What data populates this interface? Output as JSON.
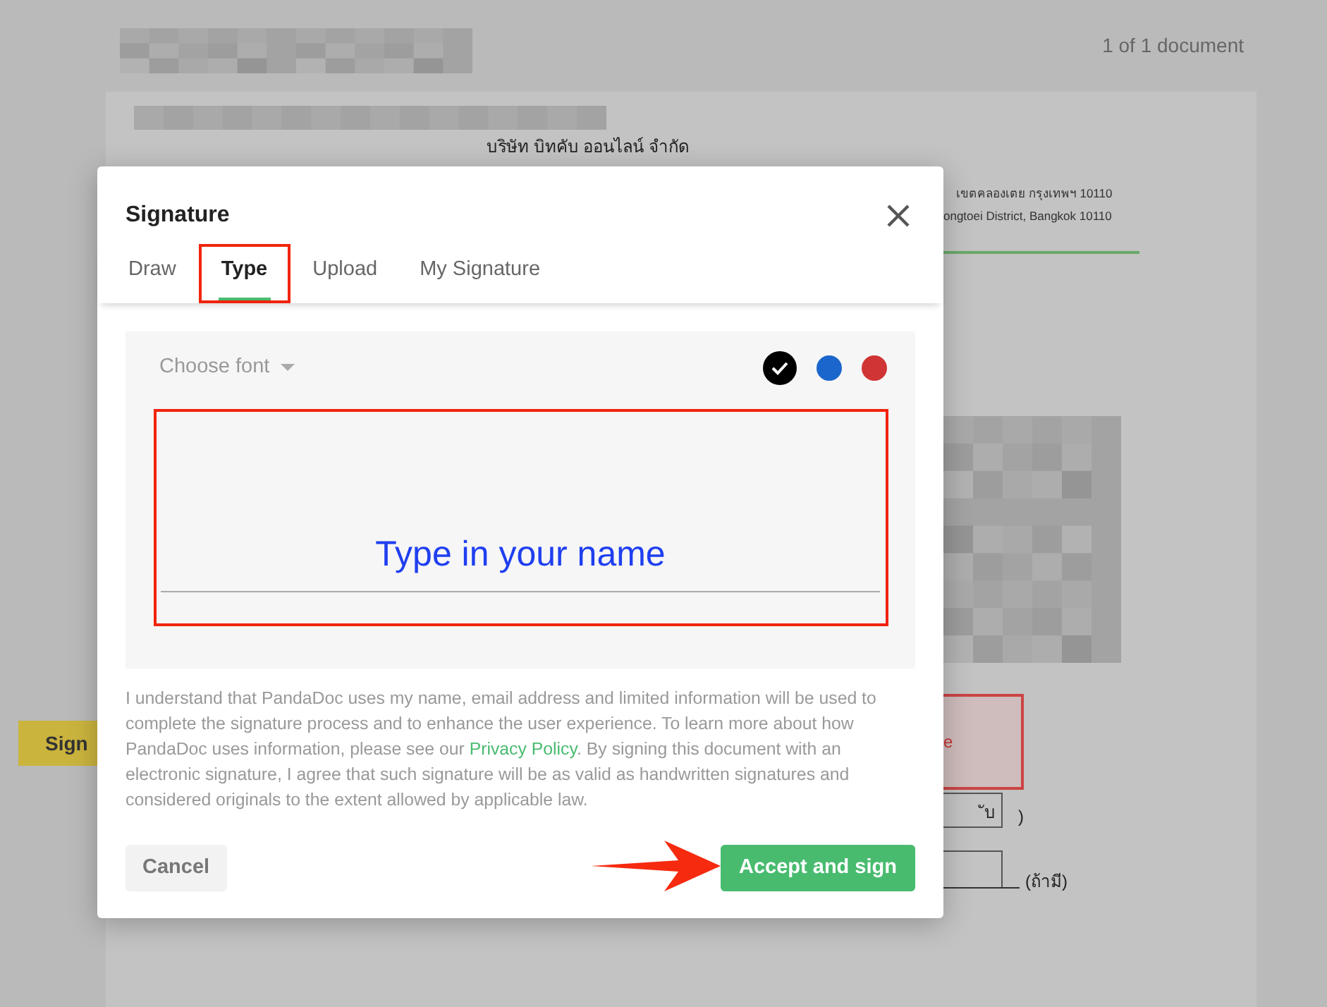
{
  "document": {
    "counter": "1 of 1 document",
    "company_th": "บริษัท บิทคับ ออนไลน์ จำกัด",
    "address_th": "เขตคลองเตย กรุงเทพฯ 10110",
    "address_en": "ongtoei District, Bangkok 10110",
    "sign_button": "Sign",
    "signature_box_text": "e",
    "field_suffix": "ับ",
    "paren": ")",
    "optional_note": "(ถ้ามี)"
  },
  "dialog": {
    "title": "Signature",
    "tabs": [
      {
        "label": "Draw",
        "selected": false
      },
      {
        "label": "Type",
        "selected": true
      },
      {
        "label": "Upload",
        "selected": false
      },
      {
        "label": "My Signature",
        "selected": false
      }
    ],
    "font_select": {
      "label": "Choose font"
    },
    "colors": [
      {
        "color": "#000000",
        "selected": true
      },
      {
        "color": "#1a66cc",
        "selected": false
      },
      {
        "color": "#d03434",
        "selected": false
      }
    ],
    "name_field": {
      "placeholder": "Type in your name"
    },
    "consent": {
      "before": "I understand that PandaDoc uses my name, email address and limited information will be used to complete the signature process and to enhance the user experience. To learn more about how PandaDoc uses information, please see our ",
      "link": "Privacy Policy",
      "after": ". By signing this document with an electronic signature, I agree that such signature will be as valid as handwritten signatures and considered originals to the extent allowed by applicable law."
    },
    "buttons": [
      {
        "label": "Cancel",
        "kind": "secondary"
      },
      {
        "label": "Accept and sign",
        "kind": "primary"
      }
    ]
  }
}
